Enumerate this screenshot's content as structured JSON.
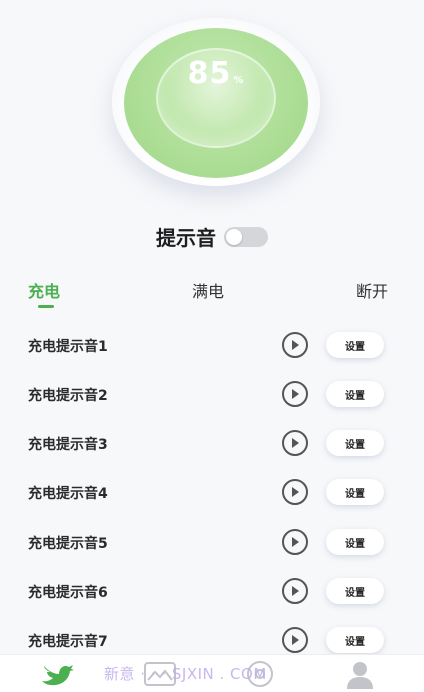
{
  "battery": {
    "value": "85",
    "unit": "%"
  },
  "sound_toggle": {
    "label": "提示音",
    "on": false
  },
  "tabs": [
    {
      "label": "充电",
      "active": true
    },
    {
      "label": "满电",
      "active": false
    },
    {
      "label": "断开",
      "active": false
    }
  ],
  "sounds": [
    {
      "label": "充电提示音1",
      "button": "设置"
    },
    {
      "label": "充电提示音2",
      "button": "设置"
    },
    {
      "label": "充电提示音3",
      "button": "设置"
    },
    {
      "label": "充电提示音4",
      "button": "设置"
    },
    {
      "label": "充电提示音5",
      "button": "设置"
    },
    {
      "label": "充电提示音6",
      "button": "设置"
    },
    {
      "label": "充电提示音7",
      "button": "设置"
    }
  ],
  "bottom_nav": {
    "items": [
      {
        "icon": "bird-icon",
        "active": true
      },
      {
        "icon": "image-icon",
        "active": false
      },
      {
        "icon": "disc-icon",
        "active": false
      },
      {
        "icon": "user-icon",
        "active": false
      }
    ],
    "watermark": "新意 · · · SJXIN . COM"
  },
  "colors": {
    "accent": "#4caf50",
    "gauge": "#a9dc92",
    "background": "#f7f8fa"
  }
}
